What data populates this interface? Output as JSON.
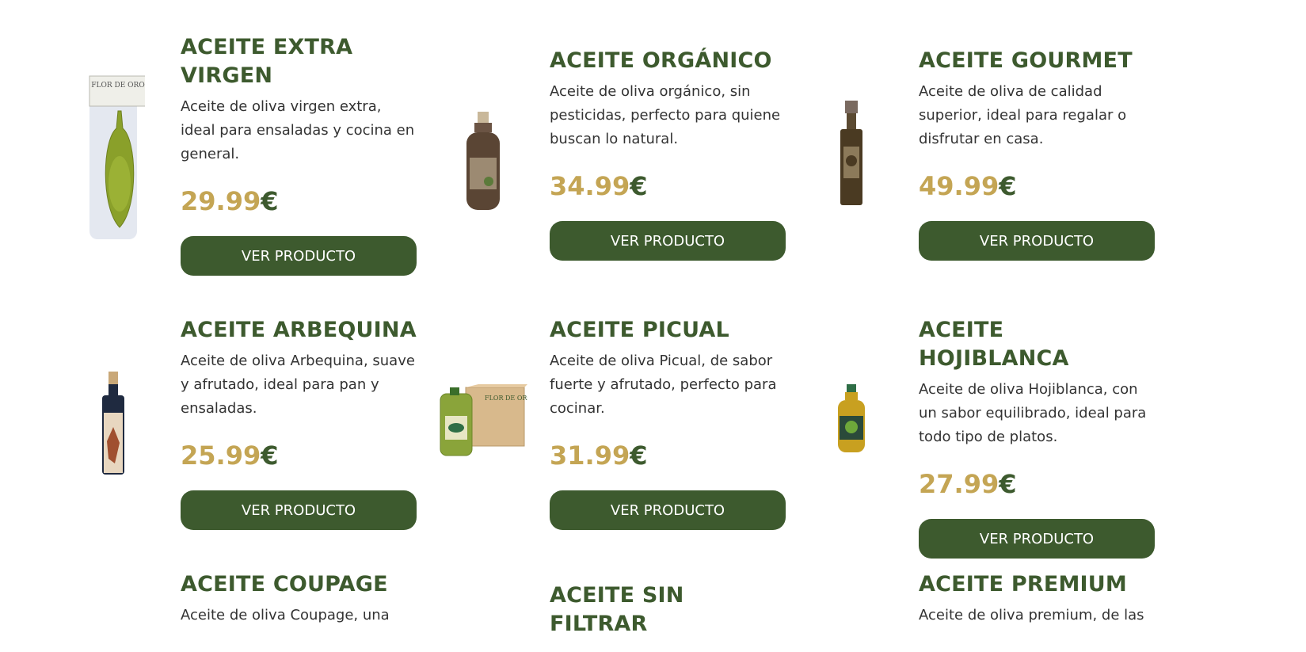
{
  "products": [
    {
      "title": "ACEITE EXTRA VIRGEN",
      "description": "Aceite de oliva virgen extra, ideal para ensaladas y cocina en general.",
      "price": "29.99",
      "currency": "€",
      "button": "VER PRODUCTO",
      "image": "olive-oil-blister-pack",
      "label_text": "FLOR DE ORO"
    },
    {
      "title": "ACEITE ORGÁNICO",
      "description": "Aceite de oliva orgánico, sin pesticidas, perfecto para quiene buscan lo natural.",
      "price": "34.99",
      "currency": "€",
      "button": "VER PRODUCTO",
      "image": "plastic-bottle-dark"
    },
    {
      "title": "ACEITE GOURMET",
      "description": "Aceite de oliva de calidad superior, ideal para regalar o disfrutar en casa.",
      "price": "49.99",
      "currency": "€",
      "button": "VER PRODUCTO",
      "image": "glass-bottle-tall"
    },
    {
      "title": "ACEITE ARBEQUINA",
      "description": "Aceite de oliva Arbequina, suave y afrutado, ideal para pan y ensaladas.",
      "price": "25.99",
      "currency": "€",
      "button": "VER PRODUCTO",
      "image": "dark-bottle-cork"
    },
    {
      "title": "ACEITE PICUAL",
      "description": "Aceite de oliva Picual, de sabor fuerte y afrutado, perfecto para cocinar.",
      "price": "31.99",
      "currency": "€",
      "button": "VER PRODUCTO",
      "image": "jug-and-box",
      "label_text": "FLOR DE ORO"
    },
    {
      "title": "ACEITE HOJIBLANCA",
      "description": "Aceite de oliva Hojiblanca, con un sabor equilibrado, ideal para todo tipo de platos.",
      "price": "27.99",
      "currency": "€",
      "button": "VER PRODUCTO",
      "image": "plastic-bottle-green-cap"
    },
    {
      "title": "ACEITE COUPAGE",
      "description": "Aceite de oliva Coupage, una",
      "price": "",
      "currency": "",
      "button": "",
      "image": ""
    },
    {
      "title": "ACEITE SIN FILTRAR",
      "description": "",
      "price": "",
      "currency": "",
      "button": "",
      "image": ""
    },
    {
      "title": "ACEITE PREMIUM",
      "description": "Aceite de oliva premium, de las",
      "price": "",
      "currency": "",
      "button": "",
      "image": ""
    }
  ],
  "colors": {
    "brand_green": "#3d5a2e",
    "price_gold": "#c4a554",
    "text": "#333333",
    "button_text": "#ffffff"
  }
}
